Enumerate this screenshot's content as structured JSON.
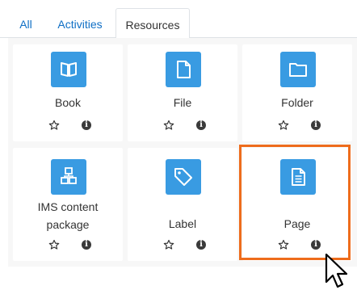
{
  "tabs": [
    {
      "label": "All"
    },
    {
      "label": "Activities"
    },
    {
      "label": "Resources"
    }
  ],
  "active_tab": "Resources",
  "modules": [
    {
      "label": "Book",
      "icon": "book-icon"
    },
    {
      "label": "File",
      "icon": "file-icon"
    },
    {
      "label": "Folder",
      "icon": "folder-icon"
    },
    {
      "label": "IMS content package",
      "label_line1": "IMS content",
      "label_line2": "package",
      "icon": "package-icon"
    },
    {
      "label": "Label",
      "icon": "tag-icon"
    },
    {
      "label": "Page",
      "icon": "page-icon"
    }
  ],
  "actions": {
    "star_icon": "star-outline-icon",
    "info_icon": "info-icon",
    "info_glyph": "i"
  },
  "colors": {
    "tile": "#399be2",
    "link": "#0f6fc5",
    "highlight": "#ee6c1c"
  }
}
